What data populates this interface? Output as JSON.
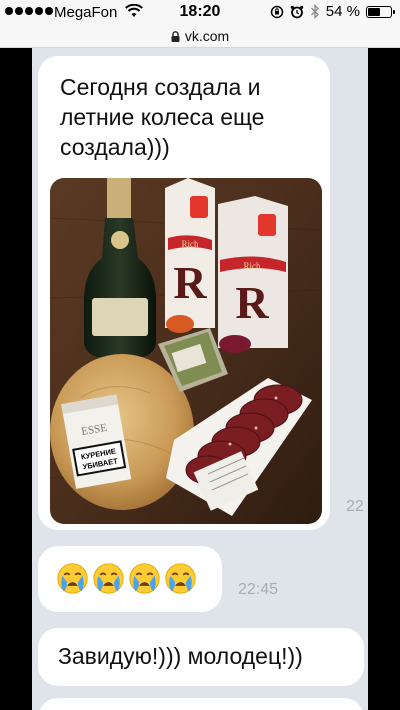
{
  "status_bar": {
    "carrier": "MegaFon",
    "time": "18:20",
    "battery_text": "54 %",
    "battery_level": 0.54,
    "icons": [
      "signal-dots-icon",
      "wifi-icon",
      "rotation-lock-icon",
      "alarm-icon",
      "bluetooth-icon",
      "battery-icon"
    ]
  },
  "browser": {
    "url": "vk.com",
    "icon": "lock-icon"
  },
  "messages": [
    {
      "text": "Сегодня создала и летние колеса еще создала)))",
      "attachment": "photo",
      "time": "22"
    },
    {
      "emoji": [
        "loudly-crying-face-icon",
        "loudly-crying-face-icon",
        "loudly-crying-face-icon",
        "loudly-crying-face-icon"
      ],
      "time": "22:45"
    },
    {
      "text": "Завидую!))) молодец!))"
    }
  ],
  "photo_labels": {
    "juice_logo": "R",
    "juice_brand": "Rich",
    "cigarette_brand": "ESSE",
    "warning_line1": "КУРЕНИЕ",
    "warning_line2": "УБИВАЕТ"
  },
  "colors": {
    "chat_background": "#dfe4ea",
    "bubble": "#ffffff",
    "time_text": "#a8adb3"
  }
}
